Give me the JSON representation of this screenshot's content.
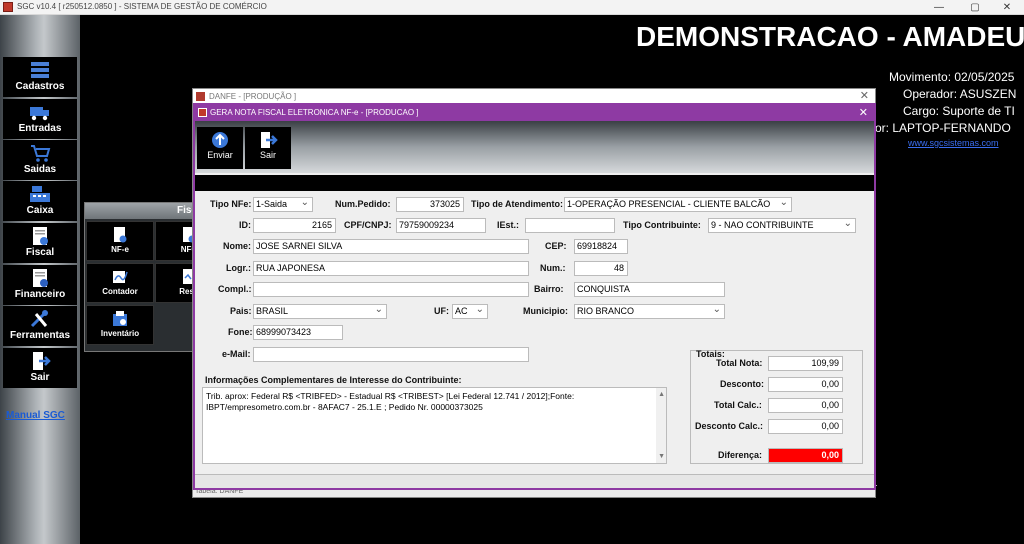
{
  "window": {
    "title": "SGC v10.4 [ r250512.0850 ] - SISTEMA DE GESTÃO DE COMÉRCIO",
    "min": "—",
    "max": "▢",
    "close": "✕"
  },
  "header": {
    "company": "DEMONSTRACAO - AMADEU",
    "movimento": "Movimento: 02/05/2025",
    "operador": "Operador: ASUSZEN",
    "cargo": "Cargo: Suporte de TI",
    "computador": "or: LAPTOP-FERNANDO",
    "site": "www.sgcsistemas.com"
  },
  "sidebar": {
    "items": [
      {
        "label": "Cadastros",
        "icon": "registry-icon"
      },
      {
        "label": "Entradas",
        "icon": "truck-icon"
      },
      {
        "label": "Saidas",
        "icon": "cart-icon"
      },
      {
        "label": "Caixa",
        "icon": "register-icon"
      },
      {
        "label": "Fiscal",
        "icon": "fiscal-doc-icon"
      },
      {
        "label": "Financeiro",
        "icon": "finance-doc-icon"
      },
      {
        "label": "Ferramentas",
        "icon": "tools-icon"
      },
      {
        "label": "Sair",
        "icon": "exit-icon"
      }
    ],
    "manual": "Manual SGC"
  },
  "fiscal_menu": {
    "title": "Fisc",
    "tiles": [
      "NF-e",
      "NFC",
      "Contador",
      "Resu",
      "Inventário"
    ]
  },
  "danfe": {
    "title": "DANFE - [PRODUÇÃO   ]",
    "status": "Tabela: DANFE",
    "close": "✕"
  },
  "nfe": {
    "title": "GERA NOTA FISCAL ELETRONICA NF-e - [PRODUCAO   ]",
    "close": "✕",
    "toolbar": {
      "enviar": "Enviar",
      "sair": "Sair"
    },
    "labels": {
      "tipo_nfe": "Tipo NFe:",
      "num_pedido": "Num.Pedido:",
      "tipo_atendimento": "Tipo de Atendimento:",
      "id": "ID:",
      "cpf": "CPF/CNPJ:",
      "iest": "IEst.:",
      "tipo_contribuinte": "Tipo Contribuinte:",
      "nome": "Nome:",
      "cep": "CEP:",
      "logr": "Logr.:",
      "num": "Num.:",
      "compl": "Compl.:",
      "bairro": "Bairro:",
      "pais": "Pais:",
      "uf": "UF:",
      "municipio": "Municipio:",
      "fone": "Fone:",
      "email": "e-Mail:",
      "info": "Informações Complementares de Interesse do Contribuinte:"
    },
    "values": {
      "tipo_nfe": "1-Saida",
      "num_pedido": "373025",
      "tipo_atendimento": "1-OPERAÇÃO PRESENCIAL - CLIENTE BALCÃO",
      "id": "2165",
      "cpf": "79759009234",
      "iest": "",
      "tipo_contribuinte": "9 - NAO CONTRIBUINTE",
      "nome": "JOSE SARNEI SILVA",
      "cep": "69918824",
      "logr": "RUA JAPONESA",
      "num": "48",
      "compl": "",
      "bairro": "CONQUISTA",
      "pais": "BRASIL",
      "uf": "AC",
      "municipio": "RIO BRANCO",
      "fone": "68999073423",
      "email": "",
      "info": "Trib. aprox: Federal R$ <TRIBFED> - Estadual R$ <TRIBEST> [Lei Federal 12.741 / 2012];Fonte: IBPT/empresometro.com.br - 8AFAC7 - 25.1.E ; Pedido Nr. 00000373025"
    },
    "totais": {
      "title": "Totais:",
      "labels": [
        "Total Nota:",
        "Desconto:",
        "Total Calc.:",
        "Desconto Calc.:",
        "Diferença:"
      ],
      "values": [
        "109,99",
        "0,00",
        "0,00",
        "0,00",
        "0,00"
      ]
    }
  }
}
